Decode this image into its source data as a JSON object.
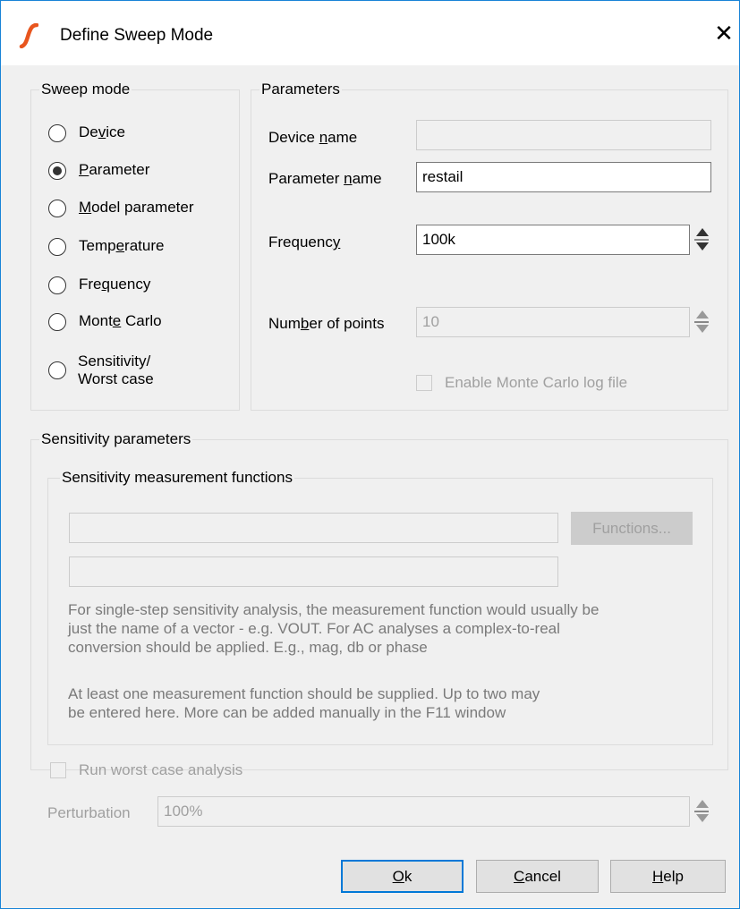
{
  "window": {
    "title": "Define Sweep Mode",
    "close_glyph": "✕",
    "logo_color": "#e8551e"
  },
  "sweep_mode": {
    "legend": "Sweep mode",
    "options": [
      {
        "pre": "De",
        "key": "v",
        "post": "ice",
        "selected": false
      },
      {
        "pre": "",
        "key": "P",
        "post": "arameter",
        "selected": true
      },
      {
        "pre": "",
        "key": "M",
        "post": "odel parameter",
        "selected": false
      },
      {
        "pre": "Temp",
        "key": "e",
        "post": "rature",
        "selected": false
      },
      {
        "pre": "Fre",
        "key": "q",
        "post": "uency",
        "selected": false
      },
      {
        "pre": "Mont",
        "key": "e",
        "post": " Carlo",
        "selected": false
      }
    ],
    "sensitivity_line1": "Sensitivity/",
    "sensitivity_line2": "Worst case"
  },
  "parameters": {
    "legend": "Parameters",
    "device_name": {
      "pre": "Device ",
      "key": "n",
      "post": "ame",
      "value": ""
    },
    "parameter_name": {
      "pre": "Parameter ",
      "key": "n",
      "post": "ame",
      "value": "restail"
    },
    "frequency": {
      "pre": "Frequenc",
      "key": "y",
      "post": "",
      "value": "100k"
    },
    "number_of_points": {
      "pre": "Num",
      "key": "b",
      "post": "er of points",
      "value": "10"
    },
    "monte_carlo_log": "Enable Monte Carlo log file"
  },
  "sensitivity_parameters": {
    "legend": "Sensitivity parameters",
    "inner_legend": "Sensitivity measurement functions",
    "function1": "",
    "function2": "",
    "functions_button": "Functions...",
    "note1": [
      "For single-step sensitivity analysis, the measurement function would usually be",
      "just the name of a vector - e.g. VOUT. For AC analyses a complex-to-real",
      "conversion should be applied. E.g., mag, db or phase"
    ],
    "note2": [
      "At least one measurement function should be supplied. Up to two may",
      "be entered here. More can be added manually in the F11 window"
    ],
    "worst_case": "Run worst case analysis",
    "perturbation_label": "Perturbation",
    "perturbation_value": "100%"
  },
  "buttons": {
    "ok": {
      "pre": "",
      "key": "O",
      "post": "k"
    },
    "cancel": {
      "pre": "",
      "key": "C",
      "post": "ancel"
    },
    "help": {
      "pre": "",
      "key": "H",
      "post": "elp"
    }
  }
}
